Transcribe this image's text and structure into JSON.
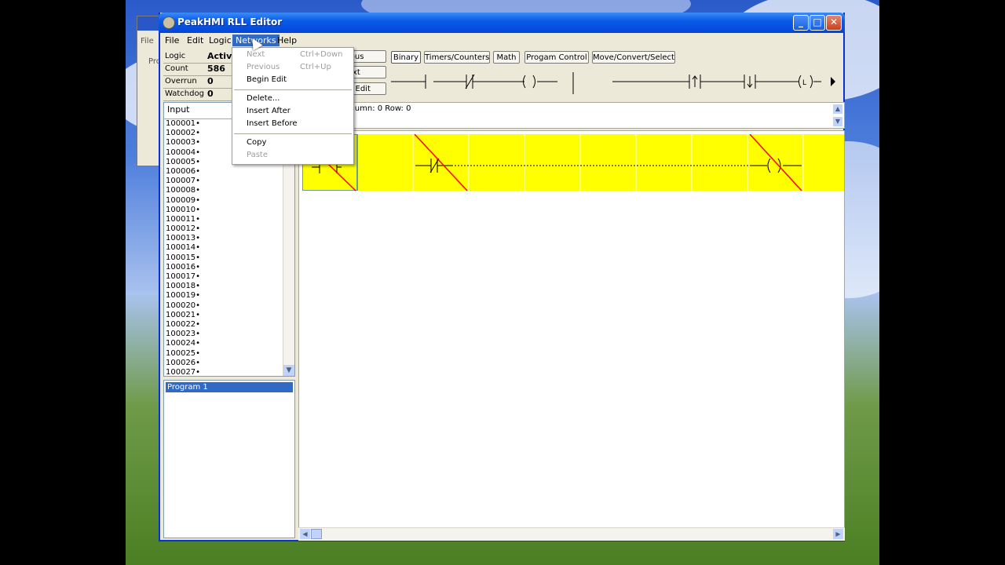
{
  "window": {
    "title": "PeakHMI RLL Editor"
  },
  "menubar": [
    {
      "label": "File"
    },
    {
      "label": "Edit"
    },
    {
      "label": "Logic"
    },
    {
      "label": "Networks"
    },
    {
      "label": "Help"
    }
  ],
  "status": {
    "logic_label": "Logic",
    "logic_value": "Active",
    "count_label": "Count",
    "count_value": "586",
    "overrun_label": "Overrun",
    "overrun_value": "0",
    "watchdog_label": "Watchdog",
    "watchdog_value": "0"
  },
  "io_list": {
    "header": "Input",
    "items": [
      "100001•",
      "100002•",
      "100003•",
      "100004•",
      "100005•",
      "100006•",
      "100007•",
      "100008•",
      "100009•",
      "100010•",
      "100011•",
      "100012•",
      "100013•",
      "100014•",
      "100015•",
      "100016•",
      "100017•",
      "100018•",
      "100019•",
      "100020•",
      "100021•",
      "100022•",
      "100023•",
      "100024•",
      "100025•",
      "100026•",
      "100027•"
    ]
  },
  "programs": {
    "items": [
      "Program 1"
    ]
  },
  "nav_buttons": {
    "previous": "Previous",
    "next": "Next",
    "begin_edit": "Begin Edit",
    "previous_visible": "ious",
    "next_visible": "ext",
    "begin_edit_visible": "n Edit"
  },
  "tabs": [
    {
      "label": "Binary"
    },
    {
      "label": "Timers/Counters"
    },
    {
      "label": "Math"
    },
    {
      "label": "Progam Control"
    },
    {
      "label": "Move/Convert/Select"
    }
  ],
  "info": {
    "coords": "lumn: 0 Row: 0"
  },
  "networks_menu": {
    "next": "Next",
    "next_shortcut": "Ctrl+Down",
    "previous": "Previous",
    "previous_shortcut": "Ctrl+Up",
    "begin_edit": "Begin Edit",
    "delete": "Delete...",
    "insert_after": "Insert After",
    "insert_before": "Insert Before",
    "copy": "Copy",
    "paste": "Paste"
  },
  "background_window": {
    "menu": "File",
    "label": "Pro"
  },
  "colors": {
    "rung": "#ffff00",
    "delete_mark": "#ff0000",
    "selection": "#316ac5",
    "titlebar": "#0a5be8"
  },
  "icons": [
    "app-icon",
    "minimize-icon",
    "maximize-icon",
    "close-icon",
    "scroll-down-icon",
    "scroll-up-icon",
    "scroll-left-icon",
    "scroll-right-icon",
    "mouse-cursor-icon"
  ]
}
